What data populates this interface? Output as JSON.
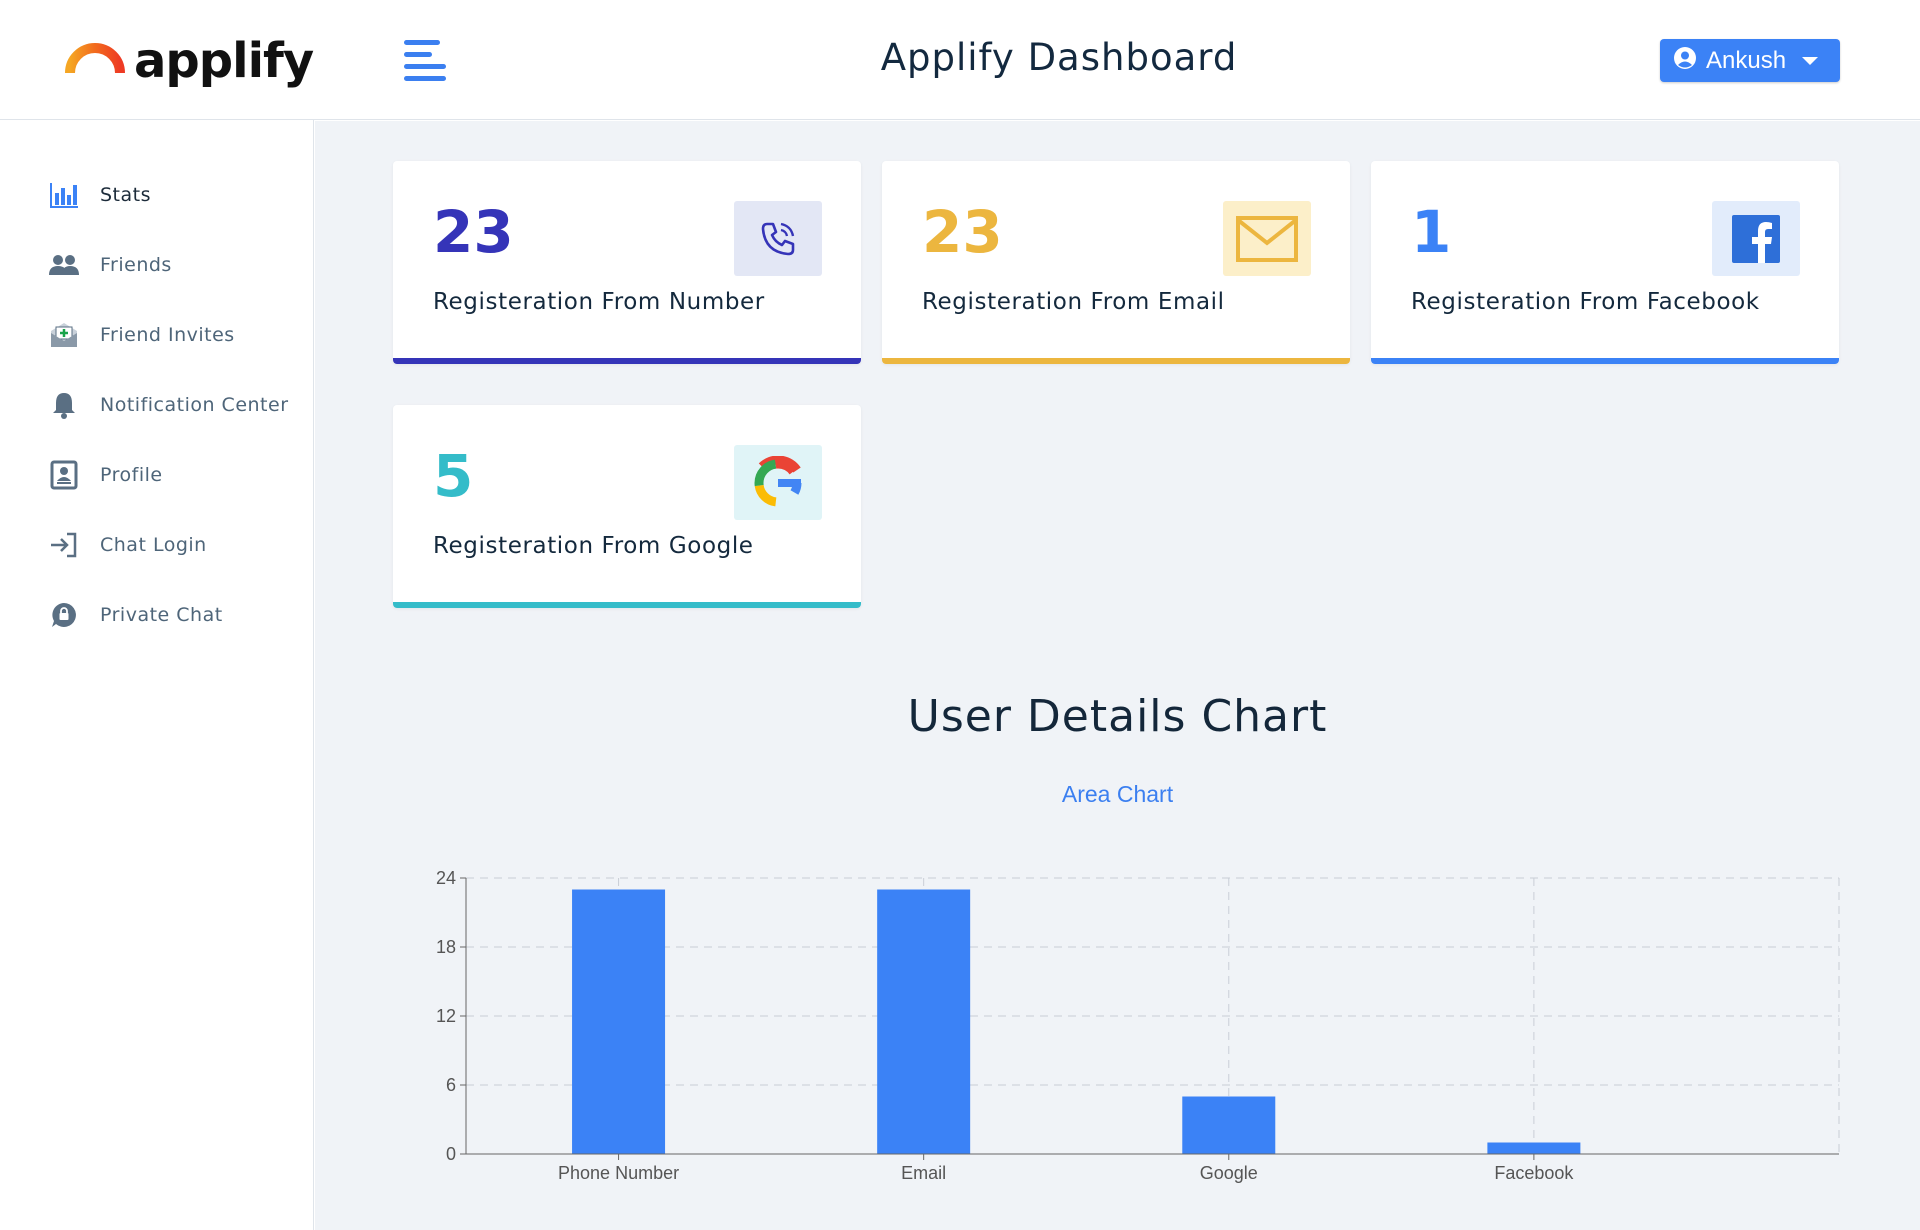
{
  "header": {
    "logo_text": "applify",
    "title": "Applify Dashboard",
    "user_name": "Ankush"
  },
  "sidebar": {
    "items": [
      {
        "label": "Stats",
        "icon": "bar-chart-icon"
      },
      {
        "label": "Friends",
        "icon": "users-icon"
      },
      {
        "label": "Friend Invites",
        "icon": "envelope-plus-icon"
      },
      {
        "label": "Notification Center",
        "icon": "bell-icon"
      },
      {
        "label": "Profile",
        "icon": "profile-card-icon"
      },
      {
        "label": "Chat Login",
        "icon": "sign-in-icon"
      },
      {
        "label": "Private Chat",
        "icon": "lock-chat-icon"
      }
    ]
  },
  "cards": [
    {
      "value": "23",
      "label": "Registeration From Number",
      "icon": "phone-icon",
      "color": "#3534b8",
      "icon_bg": "#e3e7f5"
    },
    {
      "value": "23",
      "label": "Registeration From Email",
      "icon": "envelope-icon",
      "color": "#ecb63f",
      "icon_bg": "#fcefc9"
    },
    {
      "value": "1",
      "label": "Registeration From Facebook",
      "icon": "facebook-icon",
      "color": "#3b82f6",
      "icon_bg": "#e2ecfb"
    },
    {
      "value": "5",
      "label": "Registeration From Google",
      "icon": "google-icon",
      "color": "#34bcc9",
      "icon_bg": "#e0f4f7"
    }
  ],
  "chart_section": {
    "title": "User Details Chart",
    "subtitle": "Area Chart"
  },
  "chart_data": {
    "type": "bar",
    "categories": [
      "Phone Number",
      "Email",
      "Google",
      "Facebook"
    ],
    "values": [
      23,
      23,
      5,
      1
    ],
    "ylim": [
      0,
      24
    ],
    "yticks": [
      0,
      6,
      12,
      18,
      24
    ],
    "color": "#3b82f6",
    "grid": true
  }
}
